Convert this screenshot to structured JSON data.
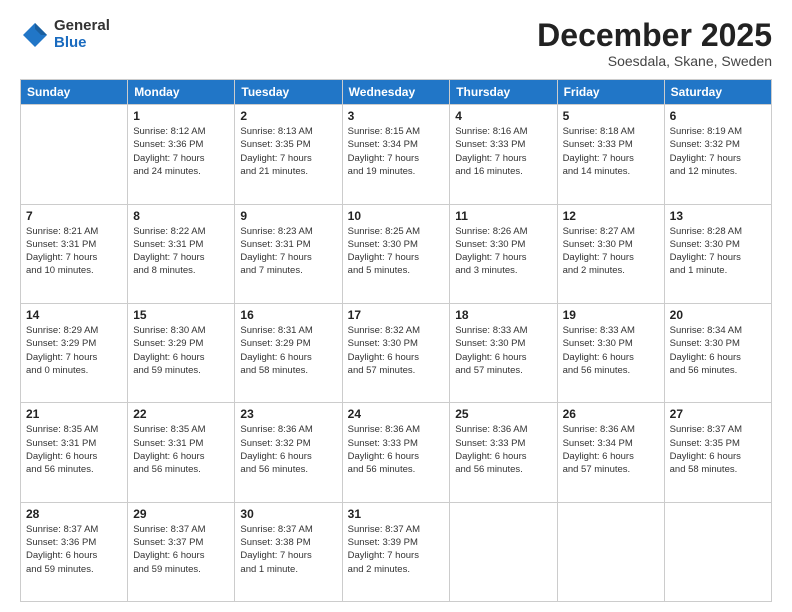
{
  "logo": {
    "general": "General",
    "blue": "Blue"
  },
  "header": {
    "month": "December 2025",
    "location": "Soesdala, Skane, Sweden"
  },
  "weekdays": [
    "Sunday",
    "Monday",
    "Tuesday",
    "Wednesday",
    "Thursday",
    "Friday",
    "Saturday"
  ],
  "weeks": [
    [
      {
        "day": "",
        "info": ""
      },
      {
        "day": "1",
        "info": "Sunrise: 8:12 AM\nSunset: 3:36 PM\nDaylight: 7 hours\nand 24 minutes."
      },
      {
        "day": "2",
        "info": "Sunrise: 8:13 AM\nSunset: 3:35 PM\nDaylight: 7 hours\nand 21 minutes."
      },
      {
        "day": "3",
        "info": "Sunrise: 8:15 AM\nSunset: 3:34 PM\nDaylight: 7 hours\nand 19 minutes."
      },
      {
        "day": "4",
        "info": "Sunrise: 8:16 AM\nSunset: 3:33 PM\nDaylight: 7 hours\nand 16 minutes."
      },
      {
        "day": "5",
        "info": "Sunrise: 8:18 AM\nSunset: 3:33 PM\nDaylight: 7 hours\nand 14 minutes."
      },
      {
        "day": "6",
        "info": "Sunrise: 8:19 AM\nSunset: 3:32 PM\nDaylight: 7 hours\nand 12 minutes."
      }
    ],
    [
      {
        "day": "7",
        "info": "Sunrise: 8:21 AM\nSunset: 3:31 PM\nDaylight: 7 hours\nand 10 minutes."
      },
      {
        "day": "8",
        "info": "Sunrise: 8:22 AM\nSunset: 3:31 PM\nDaylight: 7 hours\nand 8 minutes."
      },
      {
        "day": "9",
        "info": "Sunrise: 8:23 AM\nSunset: 3:31 PM\nDaylight: 7 hours\nand 7 minutes."
      },
      {
        "day": "10",
        "info": "Sunrise: 8:25 AM\nSunset: 3:30 PM\nDaylight: 7 hours\nand 5 minutes."
      },
      {
        "day": "11",
        "info": "Sunrise: 8:26 AM\nSunset: 3:30 PM\nDaylight: 7 hours\nand 3 minutes."
      },
      {
        "day": "12",
        "info": "Sunrise: 8:27 AM\nSunset: 3:30 PM\nDaylight: 7 hours\nand 2 minutes."
      },
      {
        "day": "13",
        "info": "Sunrise: 8:28 AM\nSunset: 3:30 PM\nDaylight: 7 hours\nand 1 minute."
      }
    ],
    [
      {
        "day": "14",
        "info": "Sunrise: 8:29 AM\nSunset: 3:29 PM\nDaylight: 7 hours\nand 0 minutes."
      },
      {
        "day": "15",
        "info": "Sunrise: 8:30 AM\nSunset: 3:29 PM\nDaylight: 6 hours\nand 59 minutes."
      },
      {
        "day": "16",
        "info": "Sunrise: 8:31 AM\nSunset: 3:29 PM\nDaylight: 6 hours\nand 58 minutes."
      },
      {
        "day": "17",
        "info": "Sunrise: 8:32 AM\nSunset: 3:30 PM\nDaylight: 6 hours\nand 57 minutes."
      },
      {
        "day": "18",
        "info": "Sunrise: 8:33 AM\nSunset: 3:30 PM\nDaylight: 6 hours\nand 57 minutes."
      },
      {
        "day": "19",
        "info": "Sunrise: 8:33 AM\nSunset: 3:30 PM\nDaylight: 6 hours\nand 56 minutes."
      },
      {
        "day": "20",
        "info": "Sunrise: 8:34 AM\nSunset: 3:30 PM\nDaylight: 6 hours\nand 56 minutes."
      }
    ],
    [
      {
        "day": "21",
        "info": "Sunrise: 8:35 AM\nSunset: 3:31 PM\nDaylight: 6 hours\nand 56 minutes."
      },
      {
        "day": "22",
        "info": "Sunrise: 8:35 AM\nSunset: 3:31 PM\nDaylight: 6 hours\nand 56 minutes."
      },
      {
        "day": "23",
        "info": "Sunrise: 8:36 AM\nSunset: 3:32 PM\nDaylight: 6 hours\nand 56 minutes."
      },
      {
        "day": "24",
        "info": "Sunrise: 8:36 AM\nSunset: 3:33 PM\nDaylight: 6 hours\nand 56 minutes."
      },
      {
        "day": "25",
        "info": "Sunrise: 8:36 AM\nSunset: 3:33 PM\nDaylight: 6 hours\nand 56 minutes."
      },
      {
        "day": "26",
        "info": "Sunrise: 8:36 AM\nSunset: 3:34 PM\nDaylight: 6 hours\nand 57 minutes."
      },
      {
        "day": "27",
        "info": "Sunrise: 8:37 AM\nSunset: 3:35 PM\nDaylight: 6 hours\nand 58 minutes."
      }
    ],
    [
      {
        "day": "28",
        "info": "Sunrise: 8:37 AM\nSunset: 3:36 PM\nDaylight: 6 hours\nand 59 minutes."
      },
      {
        "day": "29",
        "info": "Sunrise: 8:37 AM\nSunset: 3:37 PM\nDaylight: 6 hours\nand 59 minutes."
      },
      {
        "day": "30",
        "info": "Sunrise: 8:37 AM\nSunset: 3:38 PM\nDaylight: 7 hours\nand 1 minute."
      },
      {
        "day": "31",
        "info": "Sunrise: 8:37 AM\nSunset: 3:39 PM\nDaylight: 7 hours\nand 2 minutes."
      },
      {
        "day": "",
        "info": ""
      },
      {
        "day": "",
        "info": ""
      },
      {
        "day": "",
        "info": ""
      }
    ]
  ]
}
